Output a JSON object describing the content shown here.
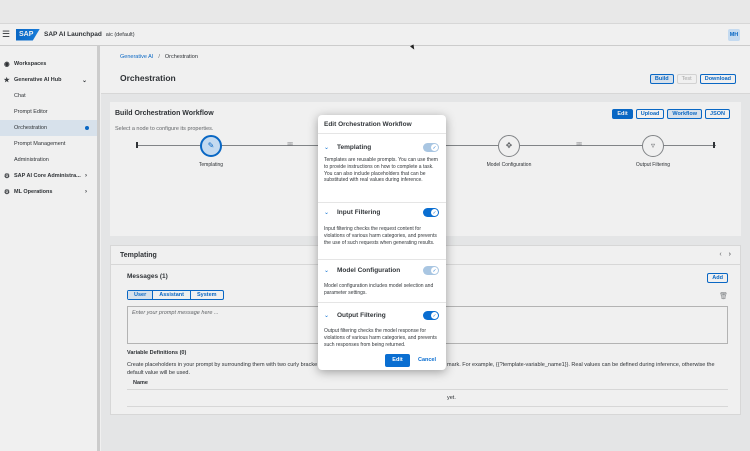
{
  "shell": {
    "app_title": "SAP AI Launchpad",
    "tenant": "aic (default)",
    "logo_text": "SAP",
    "avatar_initials": "MH"
  },
  "sidebar": {
    "items": [
      {
        "label": "Workspaces",
        "icon": "workspaces-icon"
      },
      {
        "label": "Generative AI Hub",
        "icon": "generative-ai-icon"
      },
      {
        "label": "Chat"
      },
      {
        "label": "Prompt Editor"
      },
      {
        "label": "Orchestration"
      },
      {
        "label": "Prompt Management"
      },
      {
        "label": "Administration"
      },
      {
        "label": "SAP AI Core Administra...",
        "icon": "ai-core-icon"
      },
      {
        "label": "ML Operations",
        "icon": "ml-operations-icon"
      }
    ]
  },
  "header": {
    "breadcrumb_link": "Generative AI",
    "breadcrumb_separator": "/",
    "breadcrumb_current": "Orchestration",
    "title": "Orchestration",
    "build_label": "Build",
    "test_label": "Test",
    "download_label": "Download"
  },
  "workflow": {
    "title": "Build Orchestration Workflow",
    "hint": "Select a node to configure its properties.",
    "edit_label": "Edit",
    "upload_label": "Upload",
    "workflow_label": "Workflow",
    "json_label": "JSON",
    "nodes": [
      {
        "label": "Templating"
      },
      {
        "label": "Model Configuration"
      },
      {
        "label": "Output Filtering"
      }
    ]
  },
  "templating": {
    "title": "Templating",
    "messages_title": "Messages (1)",
    "add_label": "Add",
    "roles": [
      "User",
      "Assistant",
      "System"
    ],
    "prompt_placeholder": "Enter your prompt message here ...",
    "variables_title": "Variable Definitions (0)",
    "variables_desc_left": "Create placeholders in your prompt by surrounding them with two curly bracke",
    "variables_desc_left2": "default value will be used.",
    "variables_desc_right": "mark. For example, {{?template-variable_name1}}. Real values can be defined during inference, otherwise the",
    "name_header": "Name",
    "empty_text": "yet."
  },
  "dialog": {
    "title": "Edit Orchestration Workflow",
    "sections": [
      {
        "title": "Templating",
        "enabled": true,
        "style": "light",
        "description": "Templates are reusable prompts. You can use them to provide instructions on how to complete a task. You can also include placeholders that can be substituted with real values during inference."
      },
      {
        "title": "Input Filtering",
        "enabled": true,
        "style": "dark",
        "description": "Input filtering checks the request content for violations of various harm categories, and prevents the use of such requests when generating results."
      },
      {
        "title": "Model Configuration",
        "enabled": true,
        "style": "light",
        "description": "Model configuration includes model selection and parameter settings."
      },
      {
        "title": "Output Filtering",
        "enabled": true,
        "style": "dark",
        "description": "Output filtering checks the model response for violations of various harm categories, and prevents such responses from being returned."
      }
    ],
    "edit_label": "Edit",
    "cancel_label": "Cancel"
  },
  "colors": {
    "accent": "#0a6ed1",
    "selected_bg": "#e5f0fa",
    "page_bg": "#f3f4f5"
  }
}
